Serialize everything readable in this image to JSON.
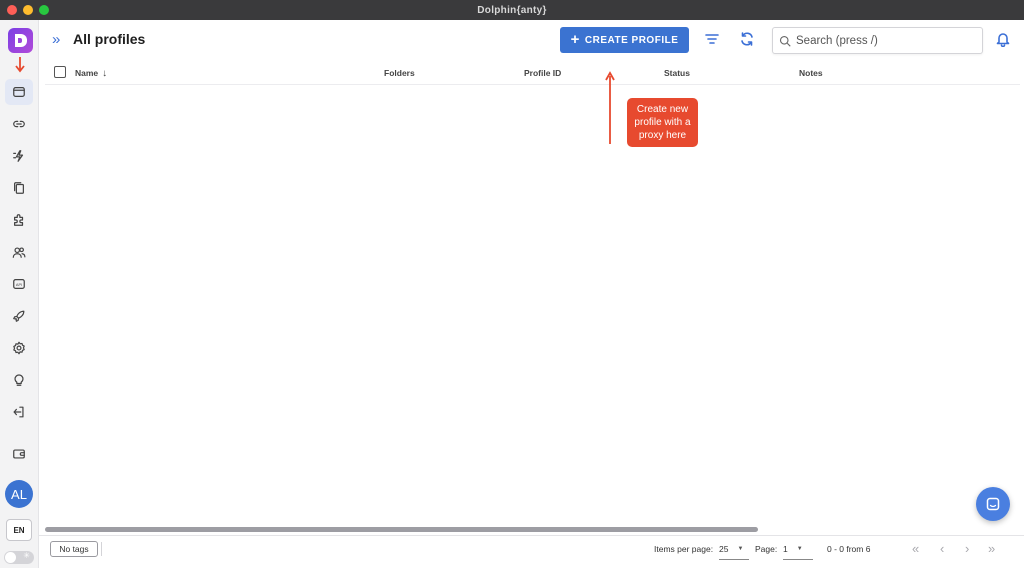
{
  "window": {
    "title": "Dolphin{anty}"
  },
  "sidebar": {
    "items": [
      {
        "name": "browser-profiles",
        "icon": "browser-window-icon",
        "active": true
      },
      {
        "name": "proxies",
        "icon": "link-icon"
      },
      {
        "name": "automation",
        "icon": "lightning-icon"
      },
      {
        "name": "templates",
        "icon": "copy-icon"
      },
      {
        "name": "extensions",
        "icon": "puzzle-icon"
      },
      {
        "name": "team",
        "icon": "users-icon"
      },
      {
        "name": "api",
        "icon": "api-icon"
      },
      {
        "name": "scenarios",
        "icon": "rocket-icon"
      },
      {
        "name": "settings",
        "icon": "gear-icon"
      },
      {
        "name": "tips",
        "icon": "lightbulb-icon"
      },
      {
        "name": "logout",
        "icon": "logout-icon"
      },
      {
        "name": "wallet",
        "icon": "wallet-icon"
      }
    ],
    "avatar": "AL",
    "language": "EN"
  },
  "header": {
    "title": "All profiles",
    "create_button": "CREATE PROFILE",
    "search_placeholder": "Search (press /)"
  },
  "table": {
    "columns": [
      "Name",
      "Folders",
      "Profile ID",
      "Status",
      "Notes"
    ]
  },
  "annotation": {
    "text": "Create new profile with a proxy here",
    "color": "#e74a2f"
  },
  "footer": {
    "tags_button": "No tags",
    "items_per_page_label": "Items per page:",
    "items_per_page": "25",
    "page_label": "Page:",
    "page": "1",
    "range": "0 - 0 from 6"
  },
  "colors": {
    "accent": "#3b73d1",
    "annotation": "#e74a2f",
    "logo": "#9b45dd"
  }
}
